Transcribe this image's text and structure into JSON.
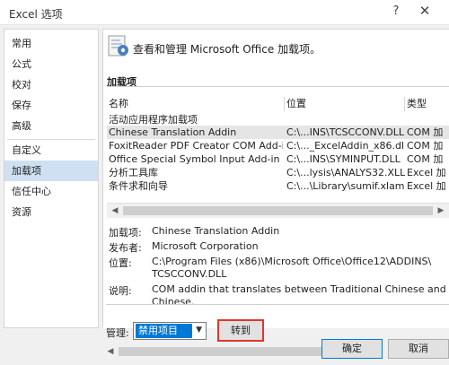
{
  "window": {
    "title": "Excel 选项",
    "help_glyph": "?",
    "close_glyph": "✕"
  },
  "sidebar": {
    "items": [
      {
        "label": "常用"
      },
      {
        "label": "公式"
      },
      {
        "label": "校对"
      },
      {
        "label": "保存"
      },
      {
        "label": "高级"
      },
      {
        "label": "自定义"
      },
      {
        "label": "加载项",
        "active": true
      },
      {
        "label": "信任中心"
      },
      {
        "label": "资源"
      }
    ]
  },
  "header": {
    "text": "查看和管理 Microsoft Office 加载项。",
    "icon": "addin-gear-icon"
  },
  "addins": {
    "section_title": "加载项",
    "columns": [
      "名称",
      "位置",
      "类型"
    ],
    "group_label": "活动应用程序加载项",
    "rows": [
      {
        "name": "Chinese Translation Addin",
        "location": "C:\\...INS\\TCSCCONV.DLL",
        "type": "COM 加",
        "selected": true
      },
      {
        "name": "FoxitReader PDF Creator COM Add-in",
        "location": "C:\\..._ExcelAddin_x86.dll",
        "type": "COM 加"
      },
      {
        "name": "Office Special Symbol Input Add-in",
        "location": "C:\\...INS\\SYMINPUT.DLL",
        "type": "COM 加"
      },
      {
        "name": "分析工具库",
        "location": "C:\\...lysis\\ANALYS32.XLL",
        "type": "Excel 加"
      },
      {
        "name": "条件求和向导",
        "location": "C:\\...\\Library\\sumif.xlam",
        "type": "Excel 加"
      }
    ]
  },
  "details": {
    "addin_label": "加载项:",
    "addin_value": "Chinese Translation Addin",
    "publisher_label": "发布者:",
    "publisher_value": "Microsoft Corporation",
    "location_label": "位置:",
    "location_value_1": "C:\\Program Files (x86)\\Microsoft Office\\Office12\\ADDINS\\",
    "location_value_2": "TCSCCONV.DLL",
    "desc_label": "说明:",
    "desc_value_1": "COM addin that translates between Traditional Chinese and Simpl",
    "desc_value_2": "Chinese."
  },
  "manage": {
    "label": "管理:",
    "selected": "禁用项目",
    "goto_label": "转到(G)..."
  },
  "buttons": {
    "ok": "确定",
    "cancel": "取消"
  },
  "scroll": {
    "left_glyph": "◀",
    "right_glyph": "▶"
  },
  "colors": {
    "accent": "#0078d7",
    "highlight_box": "#e0362d",
    "active_nav": "#cfe0f3"
  }
}
